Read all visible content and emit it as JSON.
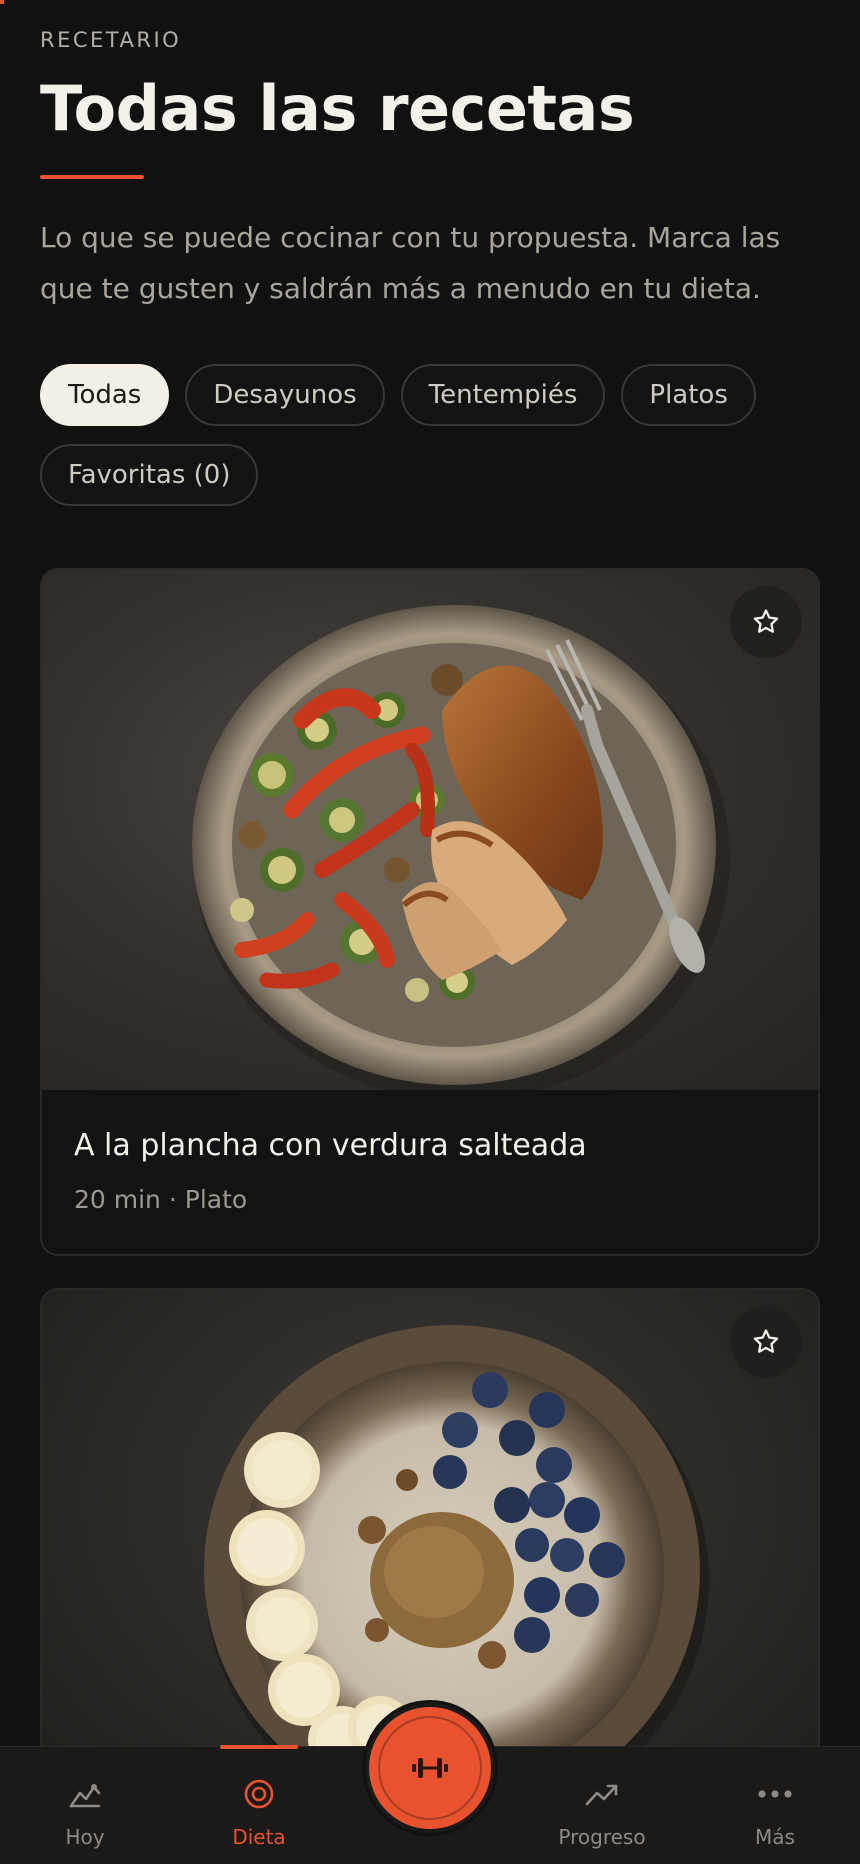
{
  "header": {
    "eyebrow": "RECETARIO",
    "title": "Todas las recetas",
    "intro": "Lo que se puede cocinar con tu propuesta. Marca las que te gusten y saldrán más a menudo en tu dieta."
  },
  "filters": {
    "chips": [
      {
        "label": "Todas",
        "active": true
      },
      {
        "label": "Desayunos",
        "active": false
      },
      {
        "label": "Tentempiés",
        "active": false
      },
      {
        "label": "Platos",
        "active": false
      },
      {
        "label": "Favoritas (0)",
        "active": false
      }
    ]
  },
  "recipes": [
    {
      "title": "A la plancha con verdura salteada",
      "meta": "20 min · Plato",
      "favorite": false
    },
    {
      "title": "",
      "meta": "",
      "favorite": false
    }
  ],
  "tabbar": {
    "tabs": [
      {
        "label": "Hoy",
        "icon": "mountain-chart-icon",
        "active": false
      },
      {
        "label": "Dieta",
        "icon": "target-icon",
        "active": true
      },
      {
        "label": "Progreso",
        "icon": "trend-up-icon",
        "active": false
      },
      {
        "label": "Más",
        "icon": "more-dots-icon",
        "active": false
      }
    ],
    "fab_icon": "dumbbell-icon"
  },
  "colors": {
    "background": "#121111",
    "accent": "#e8522f",
    "chip_active_bg": "#f3efe6",
    "text_primary": "#f4f1eb",
    "text_muted": "#a9a49c"
  }
}
